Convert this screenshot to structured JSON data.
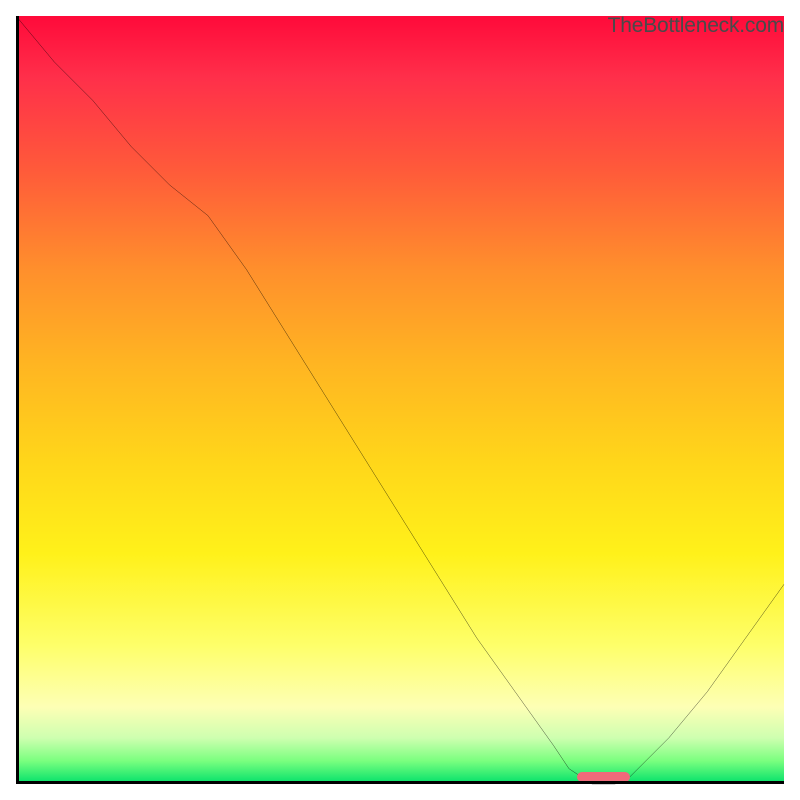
{
  "watermark": "TheBottleneck.com",
  "chart_data": {
    "type": "line",
    "title": "",
    "xlabel": "",
    "ylabel": "",
    "xlim": [
      0,
      100
    ],
    "ylim": [
      0,
      100
    ],
    "grid": false,
    "legend": false,
    "x": [
      0,
      5,
      10,
      15,
      20,
      25,
      30,
      35,
      40,
      45,
      50,
      55,
      60,
      65,
      70,
      72,
      75,
      78,
      80,
      85,
      90,
      95,
      100
    ],
    "values": [
      100,
      94,
      89,
      83,
      78,
      74,
      67,
      59,
      51,
      43,
      35,
      27,
      19,
      12,
      5,
      2,
      0,
      0,
      1,
      6,
      12,
      19,
      26
    ],
    "annotations": [
      {
        "kind": "watermark",
        "text": "TheBottleneck.com",
        "position": "top-right"
      },
      {
        "kind": "valley-marker",
        "x_start": 73,
        "x_end": 80,
        "color": "#f06a7a"
      }
    ],
    "gradient_stops": [
      {
        "pct": 0,
        "color": "#ff0a3a"
      },
      {
        "pct": 8,
        "color": "#ff2f4a"
      },
      {
        "pct": 20,
        "color": "#ff5a3a"
      },
      {
        "pct": 33,
        "color": "#ff8f2c"
      },
      {
        "pct": 45,
        "color": "#ffb422"
      },
      {
        "pct": 58,
        "color": "#ffd61a"
      },
      {
        "pct": 70,
        "color": "#fff11a"
      },
      {
        "pct": 82,
        "color": "#feff6a"
      },
      {
        "pct": 90,
        "color": "#fdffb5"
      },
      {
        "pct": 94,
        "color": "#ceffb0"
      },
      {
        "pct": 97,
        "color": "#7aff7f"
      },
      {
        "pct": 100,
        "color": "#00e06a"
      }
    ],
    "valley_marker": {
      "x_start": 73,
      "x_end": 80,
      "y": 0,
      "color": "#f06a7a"
    }
  }
}
